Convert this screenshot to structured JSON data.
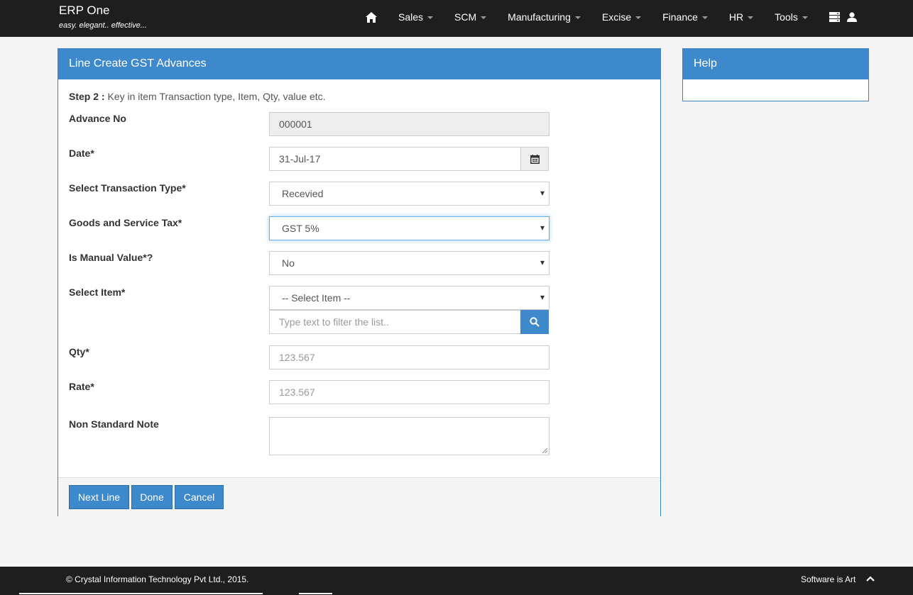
{
  "brand": {
    "name": "ERP One",
    "tagline": "easy. elegant.. effective..."
  },
  "nav": {
    "items": [
      {
        "label": "Sales"
      },
      {
        "label": "SCM"
      },
      {
        "label": "Manufacturing"
      },
      {
        "label": "Excise"
      },
      {
        "label": "Finance"
      },
      {
        "label": "HR"
      },
      {
        "label": "Tools"
      }
    ],
    "icons": [
      "home-icon",
      "server-icon",
      "user-icon"
    ]
  },
  "form": {
    "title": "Line Create GST Advances",
    "step_label": "Step 2 :",
    "step_text": " Key in item Transaction type, Item, Qty, value etc.",
    "advance_no_label": "Advance No",
    "advance_no_value": "000001",
    "date_label": "Date*",
    "date_value": "31-Jul-17",
    "transaction_type_label": "Select Transaction Type*",
    "transaction_type_value": "Recevied",
    "gst_label": "Goods and Service Tax*",
    "gst_value": "GST 5%",
    "manual_value_label": "Is Manual Value*?",
    "manual_value_value": "No",
    "item_label": "Select Item*",
    "item_value": "-- Select Item --",
    "filter_placeholder": "Type text to filter the list..",
    "qty_label": "Qty*",
    "qty_placeholder": "123.567",
    "rate_label": "Rate*",
    "rate_placeholder": "123.567",
    "note_label": "Non Standard Note",
    "note_value": ""
  },
  "buttons": {
    "next_line": "Next Line",
    "done": "Done",
    "cancel": "Cancel"
  },
  "help": {
    "title": "Help"
  },
  "footer": {
    "copyright": "© Crystal Information Technology Pvt Ltd., 2015.",
    "tagline": "Software is Art"
  },
  "colors": {
    "primary": "#3d89cb",
    "navbar": "#1e1e1e",
    "background": "#f4f4f4"
  }
}
